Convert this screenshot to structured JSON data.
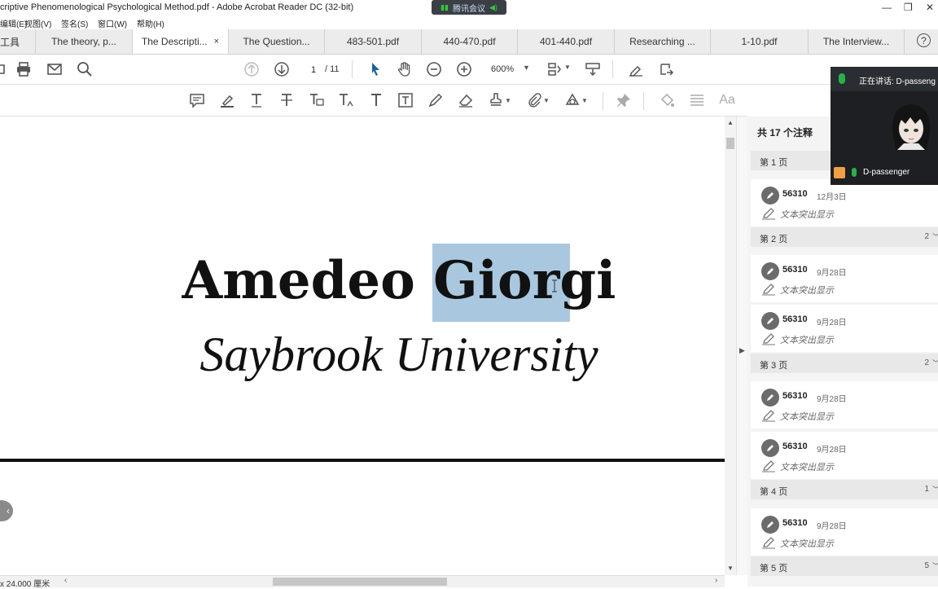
{
  "window": {
    "title": "criptive Phenomenological Psychological Method.pdf - Adobe Acrobat Reader DC (32-bit)",
    "meeting_badge": "腾讯会议",
    "controls": [
      "—",
      "❐",
      "✕"
    ]
  },
  "menu": [
    "编辑(E)",
    "视图(V)",
    "签名(S)",
    "窗口(W)",
    "帮助(H)"
  ],
  "tabs": [
    {
      "label": "工具",
      "active": false
    },
    {
      "label": "The theory, p...",
      "active": false
    },
    {
      "label": "The Descripti...",
      "active": true,
      "close": "×"
    },
    {
      "label": "The Question...",
      "active": false
    },
    {
      "label": "483-501.pdf",
      "active": false
    },
    {
      "label": "440-470.pdf",
      "active": false
    },
    {
      "label": "401-440.pdf",
      "active": false
    },
    {
      "label": "Researching ...",
      "active": false
    },
    {
      "label": "1-10.pdf",
      "active": false
    },
    {
      "label": "The Interview...",
      "active": false
    }
  ],
  "help_label": "?",
  "toolbar": {
    "page_current": "1",
    "page_total": "/ 11",
    "zoom": "600%",
    "icons": [
      "print-icon",
      "mail-icon",
      "search-icon",
      "page-up-icon",
      "page-down-icon",
      "select-arrow-icon",
      "hand-icon",
      "zoom-out-icon",
      "zoom-in-icon",
      "fit-page-icon",
      "scroll-mode-icon",
      "sign-icon",
      "share-icon"
    ]
  },
  "comment_tools": [
    "comment-icon",
    "highlight-icon",
    "text-underline-icon",
    "text-strike-icon",
    "replace-text-icon",
    "insert-text-icon",
    "add-text-icon",
    "text-box-icon",
    "pencil-icon",
    "eraser-icon",
    "stamp-icon",
    "attach-icon",
    "shapes-icon",
    "pin-icon",
    "fill-icon",
    "lines-icon",
    "font-icon"
  ],
  "comment_tool_label_aa": "Aa",
  "document": {
    "author": "Amedeo Giorgi",
    "affiliation": "Saybrook University"
  },
  "status": {
    "page_size": "x 24.000 厘米"
  },
  "comments_panel": {
    "header": "共 17 个注释",
    "groups": [
      {
        "label": "第 1 页",
        "count": "",
        "items": [
          {
            "user": "56310",
            "date": "12月3日",
            "type": "文本突出显示"
          }
        ]
      },
      {
        "label": "第 2 页",
        "count": "2",
        "items": [
          {
            "user": "56310",
            "date": "9月28日",
            "type": "文本突出显示"
          },
          {
            "user": "56310",
            "date": "9月28日",
            "type": "文本突出显示"
          }
        ]
      },
      {
        "label": "第 3 页",
        "count": "2",
        "items": [
          {
            "user": "56310",
            "date": "9月28日",
            "type": "文本突出显示"
          },
          {
            "user": "56310",
            "date": "9月28日",
            "type": "文本突出显示"
          }
        ]
      },
      {
        "label": "第 4 页",
        "count": "1",
        "items": [
          {
            "user": "56310",
            "date": "9月28日",
            "type": "文本突出显示"
          }
        ]
      },
      {
        "label": "第 5 页",
        "count": "5",
        "items": []
      }
    ]
  },
  "video": {
    "speaking": "正在讲话: D-passeng",
    "name": "D-passenger"
  }
}
